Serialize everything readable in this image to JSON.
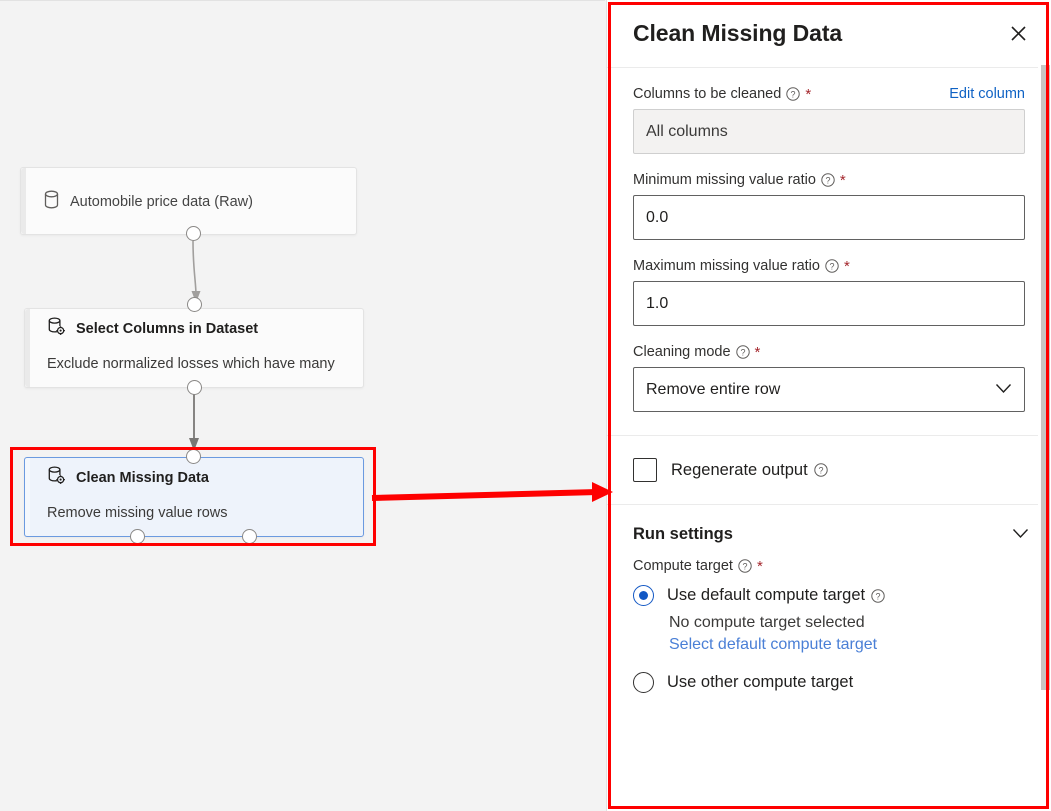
{
  "theme": {
    "canvas_bg": "#f3f3f3",
    "panel_bg": "#ffffff",
    "annotation_red": "#fe0000",
    "link_blue": "#0f62c4",
    "accent_blue": "#1358c4",
    "required_red": "#a4262c",
    "selected_node_border": "#6b9ae0",
    "selected_node_fill": "#eef3fb"
  },
  "canvas": {
    "nodes": [
      {
        "id": "automobile-price-data-raw",
        "title": "Automobile price data (Raw)",
        "subtitle": "",
        "icon": "database-icon",
        "selected": false
      },
      {
        "id": "select-columns-in-dataset",
        "title": "Select Columns in Dataset",
        "subtitle": "Exclude normalized losses which have many",
        "icon": "database-gear-icon",
        "selected": false
      },
      {
        "id": "clean-missing-data",
        "title": "Clean Missing Data",
        "subtitle": "Remove missing value rows",
        "icon": "database-gear-icon",
        "selected": true
      }
    ]
  },
  "panel": {
    "title": "Clean Missing Data",
    "close_label": "✕",
    "help_glyph": "?",
    "required_glyph": "*",
    "fields": [
      {
        "name": "columns-to-be-cleaned",
        "label": "Columns to be cleaned",
        "has_help": true,
        "required": true,
        "action_label": "Edit column",
        "control": "readonly-textbox",
        "value": "All columns"
      },
      {
        "name": "minimum-missing-value-ratio",
        "label": "Minimum missing value ratio",
        "has_help": true,
        "required": true,
        "control": "textbox",
        "value": "0.0"
      },
      {
        "name": "maximum-missing-value-ratio",
        "label": "Maximum missing value ratio",
        "has_help": true,
        "required": true,
        "control": "textbox",
        "value": "1.0"
      },
      {
        "name": "cleaning-mode",
        "label": "Cleaning mode",
        "has_help": true,
        "required": true,
        "control": "dropdown",
        "value": "Remove entire row"
      }
    ],
    "regenerate_output": {
      "label": "Regenerate output",
      "checked": false,
      "has_help": true
    },
    "run_settings": {
      "title": "Run settings",
      "expanded": true,
      "compute_target_label": "Compute target",
      "options": [
        {
          "name": "use-default-compute-target",
          "label": "Use default compute target",
          "selected": true,
          "has_help": true,
          "note": "No compute target selected",
          "link": "Select default compute target"
        },
        {
          "name": "use-other-compute-target",
          "label": "Use other compute target",
          "selected": false,
          "has_help": false
        }
      ]
    },
    "scrollbar": {
      "orientation": "vertical",
      "position": "right"
    }
  }
}
